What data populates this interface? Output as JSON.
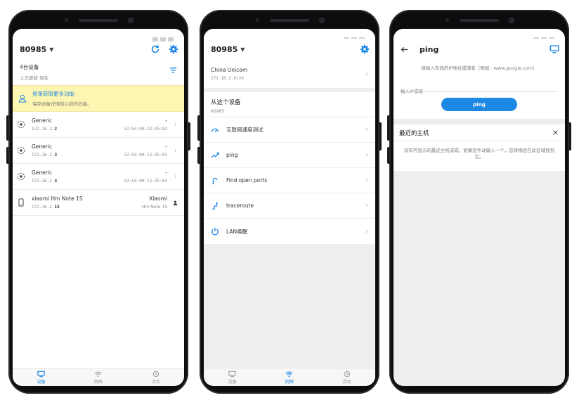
{
  "colors": {
    "accent": "#1e88e5",
    "banner_bg": "#fdf6b2",
    "text": "#212121",
    "muted": "#8c8c8c"
  },
  "screen1": {
    "header": {
      "title": "80985",
      "refresh_icon": "refresh-icon",
      "settings_icon": "gear-icon"
    },
    "summary": {
      "count": "4台设备",
      "updated": "上次更新 现在"
    },
    "banner": {
      "title": "登录获取更多功能",
      "subtitle": "保存设备详情和以前的扫描。"
    },
    "devices": [
      {
        "name": "Generic",
        "ip_prefix": "172.16.2.",
        "ip_last": "2",
        "vendor": "-",
        "mac": "52:54:00:12:35:02",
        "icon": "target-icon"
      },
      {
        "name": "Generic",
        "ip_prefix": "172.16.2.",
        "ip_last": "3",
        "vendor": "-",
        "mac": "52:54:00:12:35:03",
        "icon": "target-icon"
      },
      {
        "name": "Generic",
        "ip_prefix": "172.16.2.",
        "ip_last": "4",
        "vendor": "-",
        "mac": "52:54:00:12:35:04",
        "icon": "target-icon"
      },
      {
        "name": "xiaomi Hm Note 1S",
        "ip_prefix": "172.16.2.",
        "ip_last": "15",
        "vendor": "Xiaomi",
        "mac": "Hm Note 1S",
        "icon": "phone-icon"
      }
    ]
  },
  "screen2": {
    "header": {
      "title": "80985",
      "settings_icon": "gear-icon"
    },
    "network": {
      "name": "China Unicom",
      "subnet": "172.16.2.0/24"
    },
    "section": {
      "title": "从这个设备",
      "subtitle": "80985"
    },
    "tools": [
      {
        "label": "互联网速度测试",
        "icon": "speedometer-icon"
      },
      {
        "label": "ping",
        "icon": "trend-icon"
      },
      {
        "label": "Find open ports",
        "icon": "ports-icon"
      },
      {
        "label": "traceroute",
        "icon": "route-icon"
      },
      {
        "label": "LAN唤醒",
        "icon": "power-icon"
      }
    ]
  },
  "screen3": {
    "header": {
      "title": "ping",
      "back_icon": "back-arrow-icon",
      "monitor_icon": "monitor-icon"
    },
    "hint": "請插入有效的IP地址或域名（例如：www.google.com）",
    "input_placeholder": "輸入IP或域",
    "button": "ping",
    "recent": {
      "title": "最近的主机",
      "empty": "没有可显示的最近主机或域。如果您手动输入一个，您将稍后在此区域找到它。"
    }
  },
  "nav": {
    "devices": "设备",
    "network": "网络",
    "activity": "活动"
  }
}
